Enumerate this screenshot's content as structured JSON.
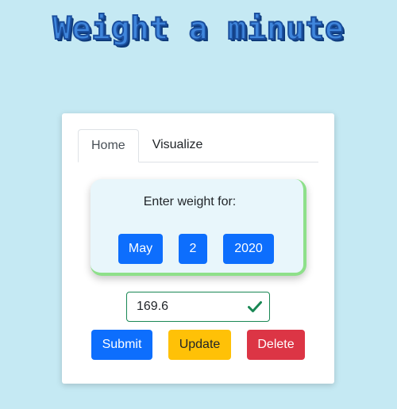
{
  "header": {
    "title": "Weight a minute"
  },
  "tabs": [
    {
      "label": "Home",
      "active": true
    },
    {
      "label": "Visualize",
      "active": false
    }
  ],
  "date_panel": {
    "prompt": "Enter weight for:",
    "month": "May",
    "day": "2",
    "year": "2020"
  },
  "weight": {
    "value": "169.6",
    "valid": true
  },
  "actions": {
    "submit": "Submit",
    "update": "Update",
    "delete": "Delete"
  },
  "colors": {
    "background": "#c5e9f3",
    "primary": "#0d6efd",
    "warning": "#ffc107",
    "danger": "#dc3545",
    "valid": "#198754",
    "panel_accent": "#8ee08a"
  },
  "icons": {
    "validation": "check-icon"
  }
}
